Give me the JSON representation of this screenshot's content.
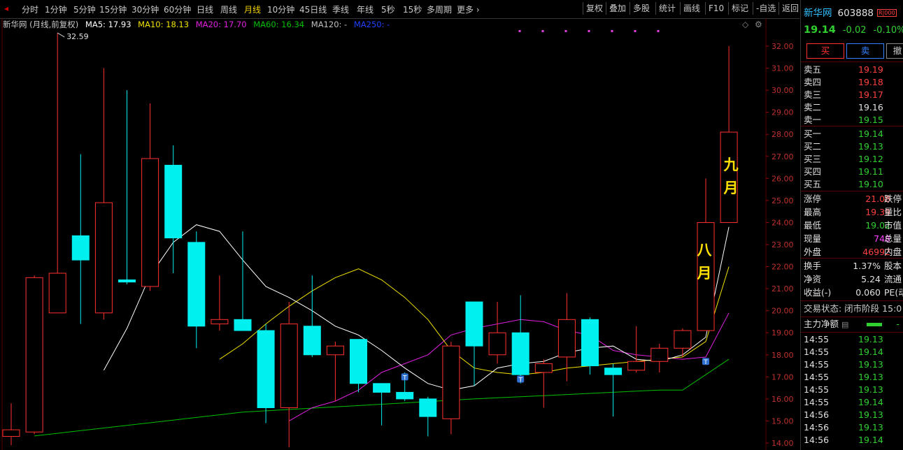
{
  "toolbar": {
    "periods": [
      "分时",
      "1分钟",
      "5分钟",
      "15分钟",
      "30分钟",
      "60分钟",
      "日线",
      "周线",
      "月线",
      "10分钟",
      "45日线",
      "季线",
      "年线",
      "5秒",
      "15秒",
      "多周期",
      "更多 ›"
    ],
    "active_period": "月线",
    "tools": [
      "复权",
      "叠加",
      "多股",
      "统计",
      "画线",
      "F10",
      "标记",
      "-自选",
      "返回"
    ]
  },
  "chart_header": {
    "title": "新华网 (月线,前复权)",
    "ma5": "MA5: 17.93",
    "ma10": "MA10: 18.13",
    "ma20": "MA20: 17.70",
    "ma60": "MA60: 16.34",
    "ma120": "MA120: -",
    "ma250": "MA250: -",
    "high_marker": "32.59",
    "colors": {
      "ma5": "#ffffff",
      "ma10": "#f0e000",
      "ma20": "#e020e0",
      "ma60": "#00c000",
      "ma120": "#c0c0c0",
      "ma250": "#2040ff",
      "up": "#ff3030",
      "down": "#00f0f0",
      "grid": "#5a0000"
    }
  },
  "annotations": {
    "aug": "八\n月",
    "sep": "九\n月"
  },
  "chart_data": {
    "type": "candlestick",
    "ylim": [
      13.8,
      32.4
    ],
    "yticks": [
      "32.00",
      "31.00",
      "30.00",
      "29.00",
      "28.00",
      "27.00",
      "26.00",
      "25.00",
      "24.00",
      "23.00",
      "22.00",
      "21.00",
      "20.00",
      "19.00",
      "18.00",
      "17.00",
      "16.00",
      "15.00",
      "14.00"
    ],
    "candles": [
      {
        "o": 14.3,
        "h": 15.8,
        "l": 13.9,
        "c": 14.6
      },
      {
        "o": 14.5,
        "h": 21.6,
        "l": 14.4,
        "c": 21.5
      },
      {
        "o": 19.9,
        "h": 32.6,
        "l": 21.2,
        "c": 21.7
      },
      {
        "o": 23.4,
        "h": 27.1,
        "l": 19.4,
        "c": 22.3
      },
      {
        "o": 19.9,
        "h": 31.0,
        "l": 19.6,
        "c": 24.9
      },
      {
        "o": 21.4,
        "h": 30.0,
        "l": 21.2,
        "c": 21.3
      },
      {
        "o": 21.1,
        "h": 29.4,
        "l": 20.9,
        "c": 26.9
      },
      {
        "o": 26.6,
        "h": 27.5,
        "l": 21.7,
        "c": 23.3
      },
      {
        "o": 23.1,
        "h": 23.6,
        "l": 18.3,
        "c": 19.3
      },
      {
        "o": 19.4,
        "h": 21.6,
        "l": 19.1,
        "c": 19.6
      },
      {
        "o": 19.6,
        "h": 23.6,
        "l": 19.1,
        "c": 19.1
      },
      {
        "o": 19.1,
        "h": 19.4,
        "l": 14.9,
        "c": 15.6
      },
      {
        "o": 15.6,
        "h": 20.4,
        "l": 13.8,
        "c": 19.4
      },
      {
        "o": 19.3,
        "h": 21.6,
        "l": 17.9,
        "c": 18.0
      },
      {
        "o": 18.0,
        "h": 18.6,
        "l": 15.9,
        "c": 18.4
      },
      {
        "o": 18.7,
        "h": 18.7,
        "l": 16.3,
        "c": 16.7
      },
      {
        "o": 16.7,
        "h": 16.7,
        "l": 14.8,
        "c": 16.3
      },
      {
        "o": 16.3,
        "h": 17.2,
        "l": 15.9,
        "c": 16.0
      },
      {
        "o": 16.0,
        "h": 16.1,
        "l": 14.3,
        "c": 15.2
      },
      {
        "o": 15.1,
        "h": 18.6,
        "l": 14.4,
        "c": 18.4
      },
      {
        "o": 20.4,
        "h": 20.4,
        "l": 16.6,
        "c": 18.4
      },
      {
        "o": 18.0,
        "h": 20.4,
        "l": 17.6,
        "c": 19.0
      },
      {
        "o": 19.0,
        "h": 20.7,
        "l": 16.7,
        "c": 17.1
      },
      {
        "o": 17.2,
        "h": 17.8,
        "l": 15.6,
        "c": 17.6
      },
      {
        "o": 17.9,
        "h": 20.8,
        "l": 16.8,
        "c": 19.6
      },
      {
        "o": 19.6,
        "h": 19.7,
        "l": 17.1,
        "c": 17.5
      },
      {
        "o": 17.4,
        "h": 17.6,
        "l": 15.2,
        "c": 17.1
      },
      {
        "o": 17.3,
        "h": 19.3,
        "l": 17.2,
        "c": 17.7
      },
      {
        "o": 17.7,
        "h": 18.5,
        "l": 17.2,
        "c": 18.3
      },
      {
        "o": 18.3,
        "h": 19.2,
        "l": 17.9,
        "c": 19.1
      },
      {
        "o": 19.1,
        "h": 26.0,
        "l": 19.1,
        "c": 24.0
      },
      {
        "o": 24.0,
        "h": 32.0,
        "l": 24.0,
        "c": 28.1
      }
    ],
    "ma5": [
      null,
      null,
      null,
      null,
      17.3,
      19.2,
      21.6,
      23.1,
      23.9,
      23.6,
      22.3,
      21.1,
      20.6,
      20.0,
      19.3,
      18.9,
      18.2,
      17.4,
      16.7,
      16.4,
      16.6,
      17.4,
      17.6,
      17.7,
      18.1,
      18.3,
      18.4,
      17.8,
      17.7,
      18.0,
      18.8,
      23.8
    ],
    "ma10": [
      null,
      null,
      null,
      null,
      null,
      null,
      null,
      null,
      null,
      17.8,
      18.5,
      19.4,
      20.2,
      20.9,
      21.5,
      21.9,
      21.4,
      20.6,
      19.6,
      18.2,
      17.4,
      17.2,
      17.1,
      17.2,
      17.4,
      17.5,
      17.6,
      17.7,
      17.8,
      17.9,
      18.6,
      22.0
    ],
    "ma20": [
      null,
      null,
      null,
      null,
      null,
      null,
      null,
      null,
      null,
      null,
      null,
      null,
      null,
      null,
      null,
      15.0,
      15.3,
      15.6,
      15.9,
      16.4,
      16.9,
      17.2,
      17.6,
      18.0,
      18.4,
      18.9,
      19.2,
      19.4,
      19.6,
      19.7,
      19.5,
      19.1,
      18.9,
      18.5,
      18.2,
      18.0,
      17.9,
      17.8,
      17.7,
      17.9,
      19.9
    ],
    "marks": [
      {
        "index": 17,
        "y": 17.0,
        "label": "T"
      },
      {
        "index": 22,
        "y": 16.9,
        "label": "T"
      },
      {
        "index": 30,
        "y": 17.7,
        "label": "T"
      }
    ]
  },
  "quote": {
    "name": "新华网",
    "code": "603888",
    "badge": "R|000",
    "price": "19.14",
    "change": "-0.02",
    "change_pct": "-0.10%",
    "buy_label": "买",
    "sell_label": "卖",
    "third_label": "撤",
    "asks": [
      {
        "label": "卖五",
        "price": "19.19",
        "color": "#ff4040"
      },
      {
        "label": "卖四",
        "price": "19.18",
        "color": "#ff4040"
      },
      {
        "label": "卖三",
        "price": "19.17",
        "color": "#ff4040"
      },
      {
        "label": "卖二",
        "price": "19.16",
        "color": "#e0e0e0"
      },
      {
        "label": "卖一",
        "price": "19.15",
        "color": "#30d030"
      }
    ],
    "bids": [
      {
        "label": "买一",
        "price": "19.14",
        "color": "#30d030"
      },
      {
        "label": "买二",
        "price": "19.13",
        "color": "#30d030"
      },
      {
        "label": "买三",
        "price": "19.12",
        "color": "#30d030"
      },
      {
        "label": "买四",
        "price": "19.11",
        "color": "#30d030"
      },
      {
        "label": "买五",
        "price": "19.10",
        "color": "#30d030"
      }
    ],
    "stats": [
      {
        "label": "涨停",
        "value": "21.08",
        "color": "#ff4040",
        "label2": "跌停"
      },
      {
        "label": "最高",
        "value": "19.39",
        "color": "#ff4040",
        "label2": "量比"
      },
      {
        "label": "最低",
        "value": "19.02",
        "color": "#30d030",
        "label2": "市值"
      },
      {
        "label": "现量",
        "value": "748",
        "color": "#ff40ff",
        "label2": "总量"
      },
      {
        "label": "外盘",
        "value": "46992",
        "color": "#ff4040",
        "label2": "内盘"
      }
    ],
    "stats2": [
      {
        "label": "换手",
        "value": "1.37%",
        "label2": "股本"
      },
      {
        "label": "净资",
        "value": "5.24",
        "label2": "流通"
      },
      {
        "label": "收益(-)",
        "value": "0.060",
        "label2": "PE(动"
      }
    ],
    "trade_status": "交易状态: 闭市阶段 15:0",
    "main_flow_label": "主力净额",
    "ticks": [
      {
        "time": "14:55",
        "price": "19.13"
      },
      {
        "time": "14:55",
        "price": "19.14"
      },
      {
        "time": "14:55",
        "price": "19.13"
      },
      {
        "time": "14:55",
        "price": "19.13"
      },
      {
        "time": "14:55",
        "price": "19.13"
      },
      {
        "time": "14:55",
        "price": "19.14"
      },
      {
        "time": "14:56",
        "price": "19.13"
      },
      {
        "time": "14:56",
        "price": "19.13"
      },
      {
        "time": "14:56",
        "price": "19.14"
      }
    ]
  }
}
